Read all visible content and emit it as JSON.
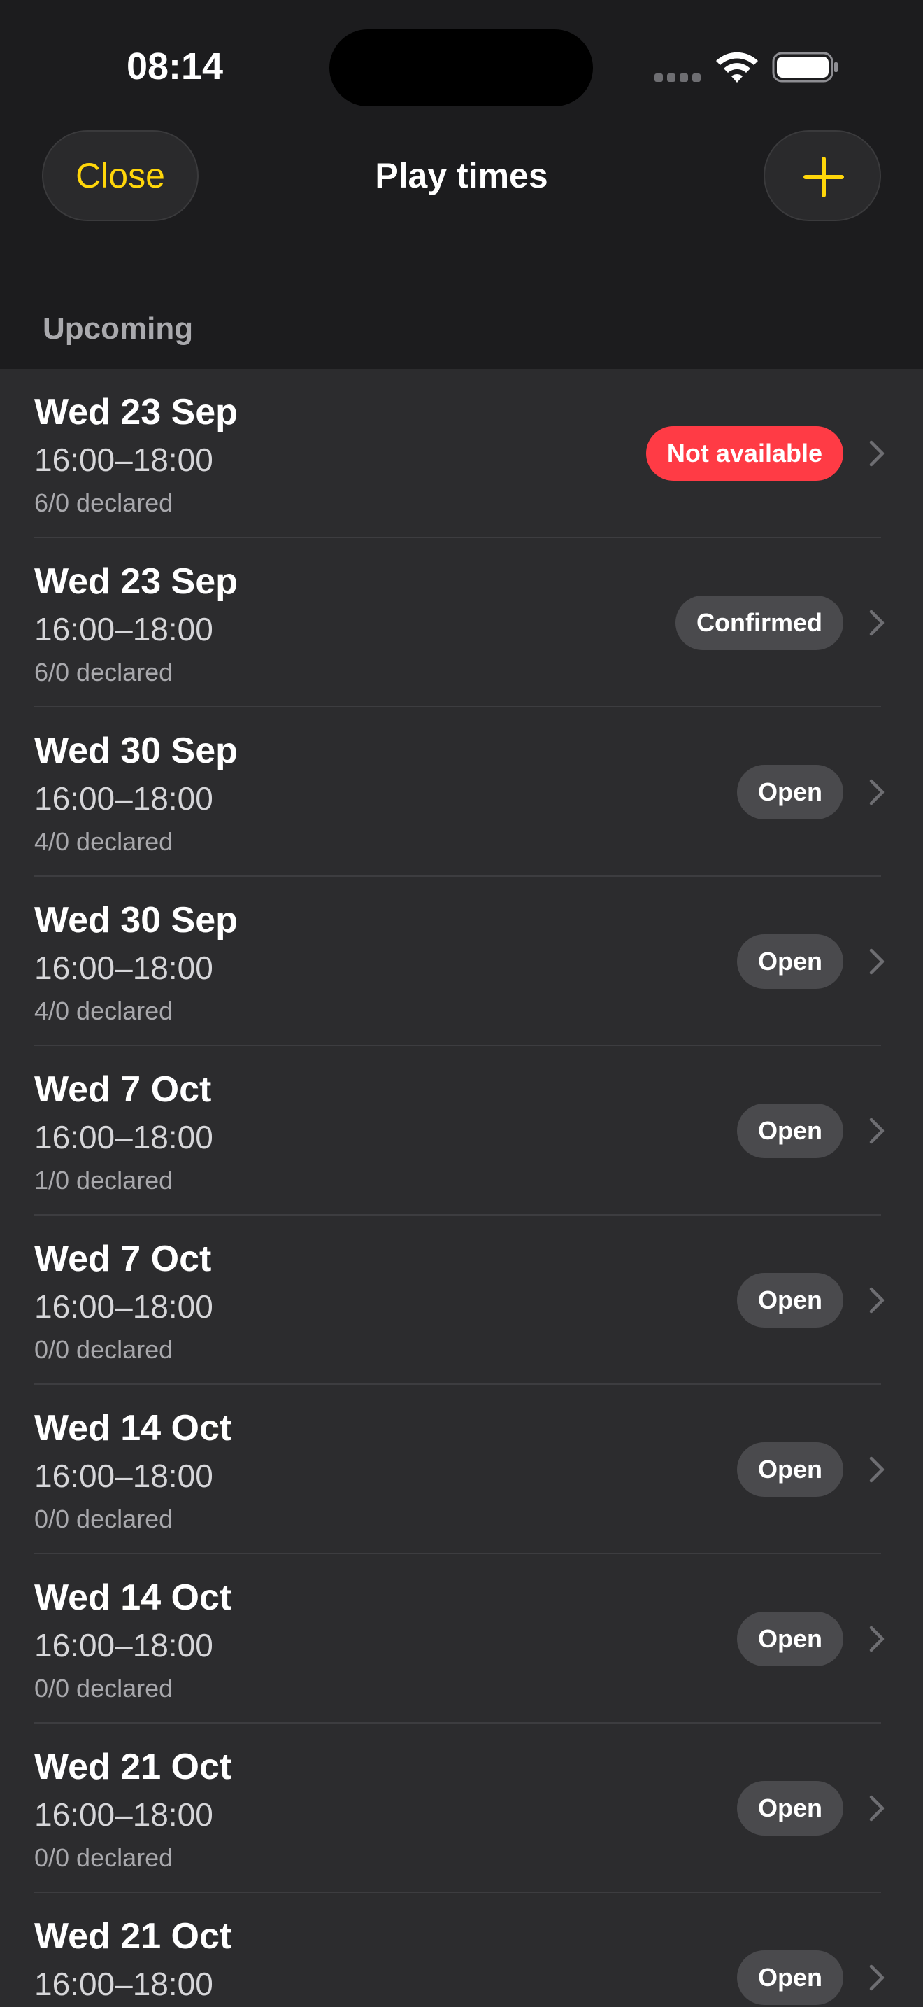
{
  "status_bar": {
    "time": "08:14"
  },
  "nav": {
    "close_label": "Close",
    "title": "Play times",
    "accent_color": "#ffd60a"
  },
  "section": {
    "title": "Upcoming"
  },
  "rows": [
    {
      "date": "Wed 23 Sep",
      "time": "16:00–18:00",
      "declared": "6/0 declared",
      "status": "Not available",
      "status_color": "#ff3b45"
    },
    {
      "date": "Wed 23 Sep",
      "time": "16:00–18:00",
      "declared": "6/0 declared",
      "status": "Confirmed",
      "status_color": "#4a4a4d"
    },
    {
      "date": "Wed 30 Sep",
      "time": "16:00–18:00",
      "declared": "4/0 declared",
      "status": "Open",
      "status_color": "#4a4a4d"
    },
    {
      "date": "Wed 30 Sep",
      "time": "16:00–18:00",
      "declared": "4/0 declared",
      "status": "Open",
      "status_color": "#4a4a4d"
    },
    {
      "date": "Wed 7 Oct",
      "time": "16:00–18:00",
      "declared": "1/0 declared",
      "status": "Open",
      "status_color": "#4a4a4d"
    },
    {
      "date": "Wed 7 Oct",
      "time": "16:00–18:00",
      "declared": "0/0 declared",
      "status": "Open",
      "status_color": "#4a4a4d"
    },
    {
      "date": "Wed 14 Oct",
      "time": "16:00–18:00",
      "declared": "0/0 declared",
      "status": "Open",
      "status_color": "#4a4a4d"
    },
    {
      "date": "Wed 14 Oct",
      "time": "16:00–18:00",
      "declared": "0/0 declared",
      "status": "Open",
      "status_color": "#4a4a4d"
    },
    {
      "date": "Wed 21 Oct",
      "time": "16:00–18:00",
      "declared": "0/0 declared",
      "status": "Open",
      "status_color": "#4a4a4d"
    },
    {
      "date": "Wed 21 Oct",
      "time": "16:00–18:00",
      "declared": "",
      "status": "Open",
      "status_color": "#4a4a4d"
    }
  ]
}
